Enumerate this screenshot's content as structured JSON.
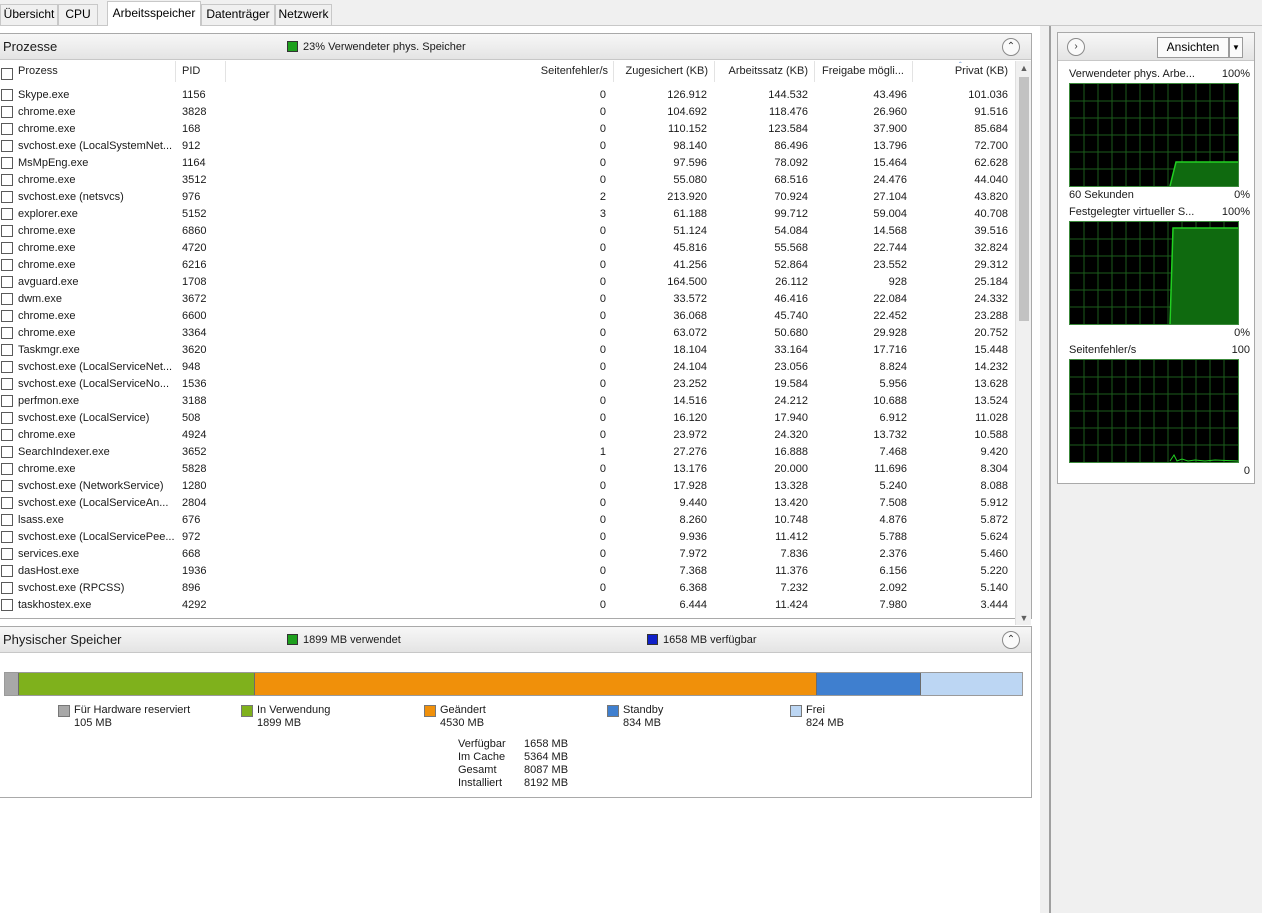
{
  "tabs": [
    {
      "label": "Übersicht",
      "active": false
    },
    {
      "label": "CPU",
      "active": false
    },
    {
      "label": "Arbeitsspeicher",
      "active": true
    },
    {
      "label": "Datenträger",
      "active": false
    },
    {
      "label": "Netzwerk",
      "active": false
    }
  ],
  "processes_panel": {
    "title": "Prozesse",
    "summary": "23% Verwendeter phys. Speicher",
    "columns": [
      "Prozess",
      "PID",
      "Seitenfehler/s",
      "Zugesichert (KB)",
      "Arbeitssatz (KB)",
      "Freigabe mögli...",
      "Privat (KB)"
    ],
    "rows": [
      [
        "Skype.exe",
        "1156",
        "0",
        "126.912",
        "144.532",
        "43.496",
        "101.036"
      ],
      [
        "chrome.exe",
        "3828",
        "0",
        "104.692",
        "118.476",
        "26.960",
        "91.516"
      ],
      [
        "chrome.exe",
        "168",
        "0",
        "110.152",
        "123.584",
        "37.900",
        "85.684"
      ],
      [
        "svchost.exe (LocalSystemNet...",
        "912",
        "0",
        "98.140",
        "86.496",
        "13.796",
        "72.700"
      ],
      [
        "MsMpEng.exe",
        "1164",
        "0",
        "97.596",
        "78.092",
        "15.464",
        "62.628"
      ],
      [
        "chrome.exe",
        "3512",
        "0",
        "55.080",
        "68.516",
        "24.476",
        "44.040"
      ],
      [
        "svchost.exe (netsvcs)",
        "976",
        "2",
        "213.920",
        "70.924",
        "27.104",
        "43.820"
      ],
      [
        "explorer.exe",
        "5152",
        "3",
        "61.188",
        "99.712",
        "59.004",
        "40.708"
      ],
      [
        "chrome.exe",
        "6860",
        "0",
        "51.124",
        "54.084",
        "14.568",
        "39.516"
      ],
      [
        "chrome.exe",
        "4720",
        "0",
        "45.816",
        "55.568",
        "22.744",
        "32.824"
      ],
      [
        "chrome.exe",
        "6216",
        "0",
        "41.256",
        "52.864",
        "23.552",
        "29.312"
      ],
      [
        "avguard.exe",
        "1708",
        "0",
        "164.500",
        "26.112",
        "928",
        "25.184"
      ],
      [
        "dwm.exe",
        "3672",
        "0",
        "33.572",
        "46.416",
        "22.084",
        "24.332"
      ],
      [
        "chrome.exe",
        "6600",
        "0",
        "36.068",
        "45.740",
        "22.452",
        "23.288"
      ],
      [
        "chrome.exe",
        "3364",
        "0",
        "63.072",
        "50.680",
        "29.928",
        "20.752"
      ],
      [
        "Taskmgr.exe",
        "3620",
        "0",
        "18.104",
        "33.164",
        "17.716",
        "15.448"
      ],
      [
        "svchost.exe (LocalServiceNet...",
        "948",
        "0",
        "24.104",
        "23.056",
        "8.824",
        "14.232"
      ],
      [
        "svchost.exe (LocalServiceNo...",
        "1536",
        "0",
        "23.252",
        "19.584",
        "5.956",
        "13.628"
      ],
      [
        "perfmon.exe",
        "3188",
        "0",
        "14.516",
        "24.212",
        "10.688",
        "13.524"
      ],
      [
        "svchost.exe (LocalService)",
        "508",
        "0",
        "16.120",
        "17.940",
        "6.912",
        "11.028"
      ],
      [
        "chrome.exe",
        "4924",
        "0",
        "23.972",
        "24.320",
        "13.732",
        "10.588"
      ],
      [
        "SearchIndexer.exe",
        "3652",
        "1",
        "27.276",
        "16.888",
        "7.468",
        "9.420"
      ],
      [
        "chrome.exe",
        "5828",
        "0",
        "13.176",
        "20.000",
        "11.696",
        "8.304"
      ],
      [
        "svchost.exe (NetworkService)",
        "1280",
        "0",
        "17.928",
        "13.328",
        "5.240",
        "8.088"
      ],
      [
        "svchost.exe (LocalServiceAn...",
        "2804",
        "0",
        "9.440",
        "13.420",
        "7.508",
        "5.912"
      ],
      [
        "lsass.exe",
        "676",
        "0",
        "8.260",
        "10.748",
        "4.876",
        "5.872"
      ],
      [
        "svchost.exe (LocalServicePee...",
        "972",
        "0",
        "9.936",
        "11.412",
        "5.788",
        "5.624"
      ],
      [
        "services.exe",
        "668",
        "0",
        "7.972",
        "7.836",
        "2.376",
        "5.460"
      ],
      [
        "dasHost.exe",
        "1936",
        "0",
        "7.368",
        "11.376",
        "6.156",
        "5.220"
      ],
      [
        "svchost.exe (RPCSS)",
        "896",
        "0",
        "6.368",
        "7.232",
        "2.092",
        "5.140"
      ],
      [
        "taskhostex.exe",
        "4292",
        "0",
        "6.444",
        "11.424",
        "7.980",
        "3.444"
      ]
    ]
  },
  "physical_panel": {
    "title": "Physischer Speicher",
    "used_summary": "1899 MB verwendet",
    "available_summary": "1658 MB verfügbar",
    "legend": [
      {
        "label": "Für Hardware reserviert",
        "value": "105 MB",
        "color": "#a8a8a8"
      },
      {
        "label": "In Verwendung",
        "value": "1899 MB",
        "color": "#7fb11c"
      },
      {
        "label": "Geändert",
        "value": "4530 MB",
        "color": "#f0900a"
      },
      {
        "label": "Standby",
        "value": "834 MB",
        "color": "#3f7fcf"
      },
      {
        "label": "Frei",
        "value": "824 MB",
        "color": "#bcd6f3"
      }
    ],
    "bar_fractions": [
      0.013,
      0.232,
      0.553,
      0.102,
      0.1
    ],
    "stats": [
      {
        "label": "Verfügbar",
        "value": "1658 MB"
      },
      {
        "label": "Im Cache",
        "value": "5364 MB"
      },
      {
        "label": "Gesamt",
        "value": "8087 MB"
      },
      {
        "label": "Installiert",
        "value": "8192 MB"
      }
    ]
  },
  "graphs": {
    "view_button": "Ansichten",
    "items": [
      {
        "title": "Verwendeter phys. Arbe...",
        "max": "100%",
        "xlabel": "60 Sekunden",
        "min": "0%"
      },
      {
        "title": "Festgelegter virtueller S...",
        "max": "100%",
        "xlabel": "",
        "min": "0%"
      },
      {
        "title": "Seitenfehler/s",
        "max": "100",
        "xlabel": "",
        "min": "0"
      }
    ]
  },
  "colors": {
    "used_chip": "#1ea01e",
    "available_chip": "#1020c8",
    "graph_line": "#22d022",
    "graph_fill": "#0f6a0f"
  }
}
